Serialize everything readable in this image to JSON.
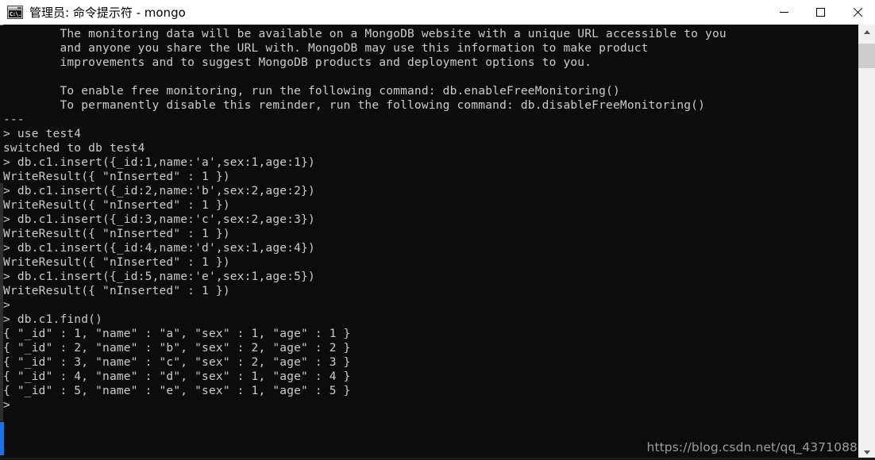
{
  "window": {
    "title": "管理员: 命令提示符 - mongo",
    "icon": "cmd-console-icon",
    "icon_text": "C:\\.",
    "background": "#0c0c0c",
    "text_color": "#cccccc",
    "titlebar_background": "#ffffff",
    "accent_color": "#1a74e8"
  },
  "controls": {
    "minimize": "minimize",
    "maximize": "maximize",
    "close": "close"
  },
  "scrollbar": {
    "up_arrow": "scroll-up",
    "down_arrow": "scroll-down",
    "thumb": "scroll-thumb"
  },
  "watermark": {
    "text": "https://blog.csdn.net/qq_4371088"
  },
  "terminal": {
    "lines": [
      "        The monitoring data will be available on a MongoDB website with a unique URL accessible to you",
      "        and anyone you share the URL with. MongoDB may use this information to make product",
      "        improvements and to suggest MongoDB products and deployment options to you.",
      "",
      "        To enable free monitoring, run the following command: db.enableFreeMonitoring()",
      "        To permanently disable this reminder, run the following command: db.disableFreeMonitoring()",
      "---",
      "> use test4",
      "switched to db test4",
      "> db.c1.insert({_id:1,name:'a',sex:1,age:1})",
      "WriteResult({ \"nInserted\" : 1 })",
      "> db.c1.insert({_id:2,name:'b',sex:2,age:2})",
      "WriteResult({ \"nInserted\" : 1 })",
      "> db.c1.insert({_id:3,name:'c',sex:2,age:3})",
      "WriteResult({ \"nInserted\" : 1 })",
      "> db.c1.insert({_id:4,name:'d',sex:1,age:4})",
      "WriteResult({ \"nInserted\" : 1 })",
      "> db.c1.insert({_id:5,name:'e',sex:1,age:5})",
      "WriteResult({ \"nInserted\" : 1 })",
      ">",
      "> db.c1.find()",
      "{ \"_id\" : 1, \"name\" : \"a\", \"sex\" : 1, \"age\" : 1 }",
      "{ \"_id\" : 2, \"name\" : \"b\", \"sex\" : 2, \"age\" : 2 }",
      "{ \"_id\" : 3, \"name\" : \"c\", \"sex\" : 2, \"age\" : 3 }",
      "{ \"_id\" : 4, \"name\" : \"d\", \"sex\" : 1, \"age\" : 4 }",
      "{ \"_id\" : 5, \"name\" : \"e\", \"sex\" : 1, \"age\" : 5 }",
      ">"
    ]
  }
}
